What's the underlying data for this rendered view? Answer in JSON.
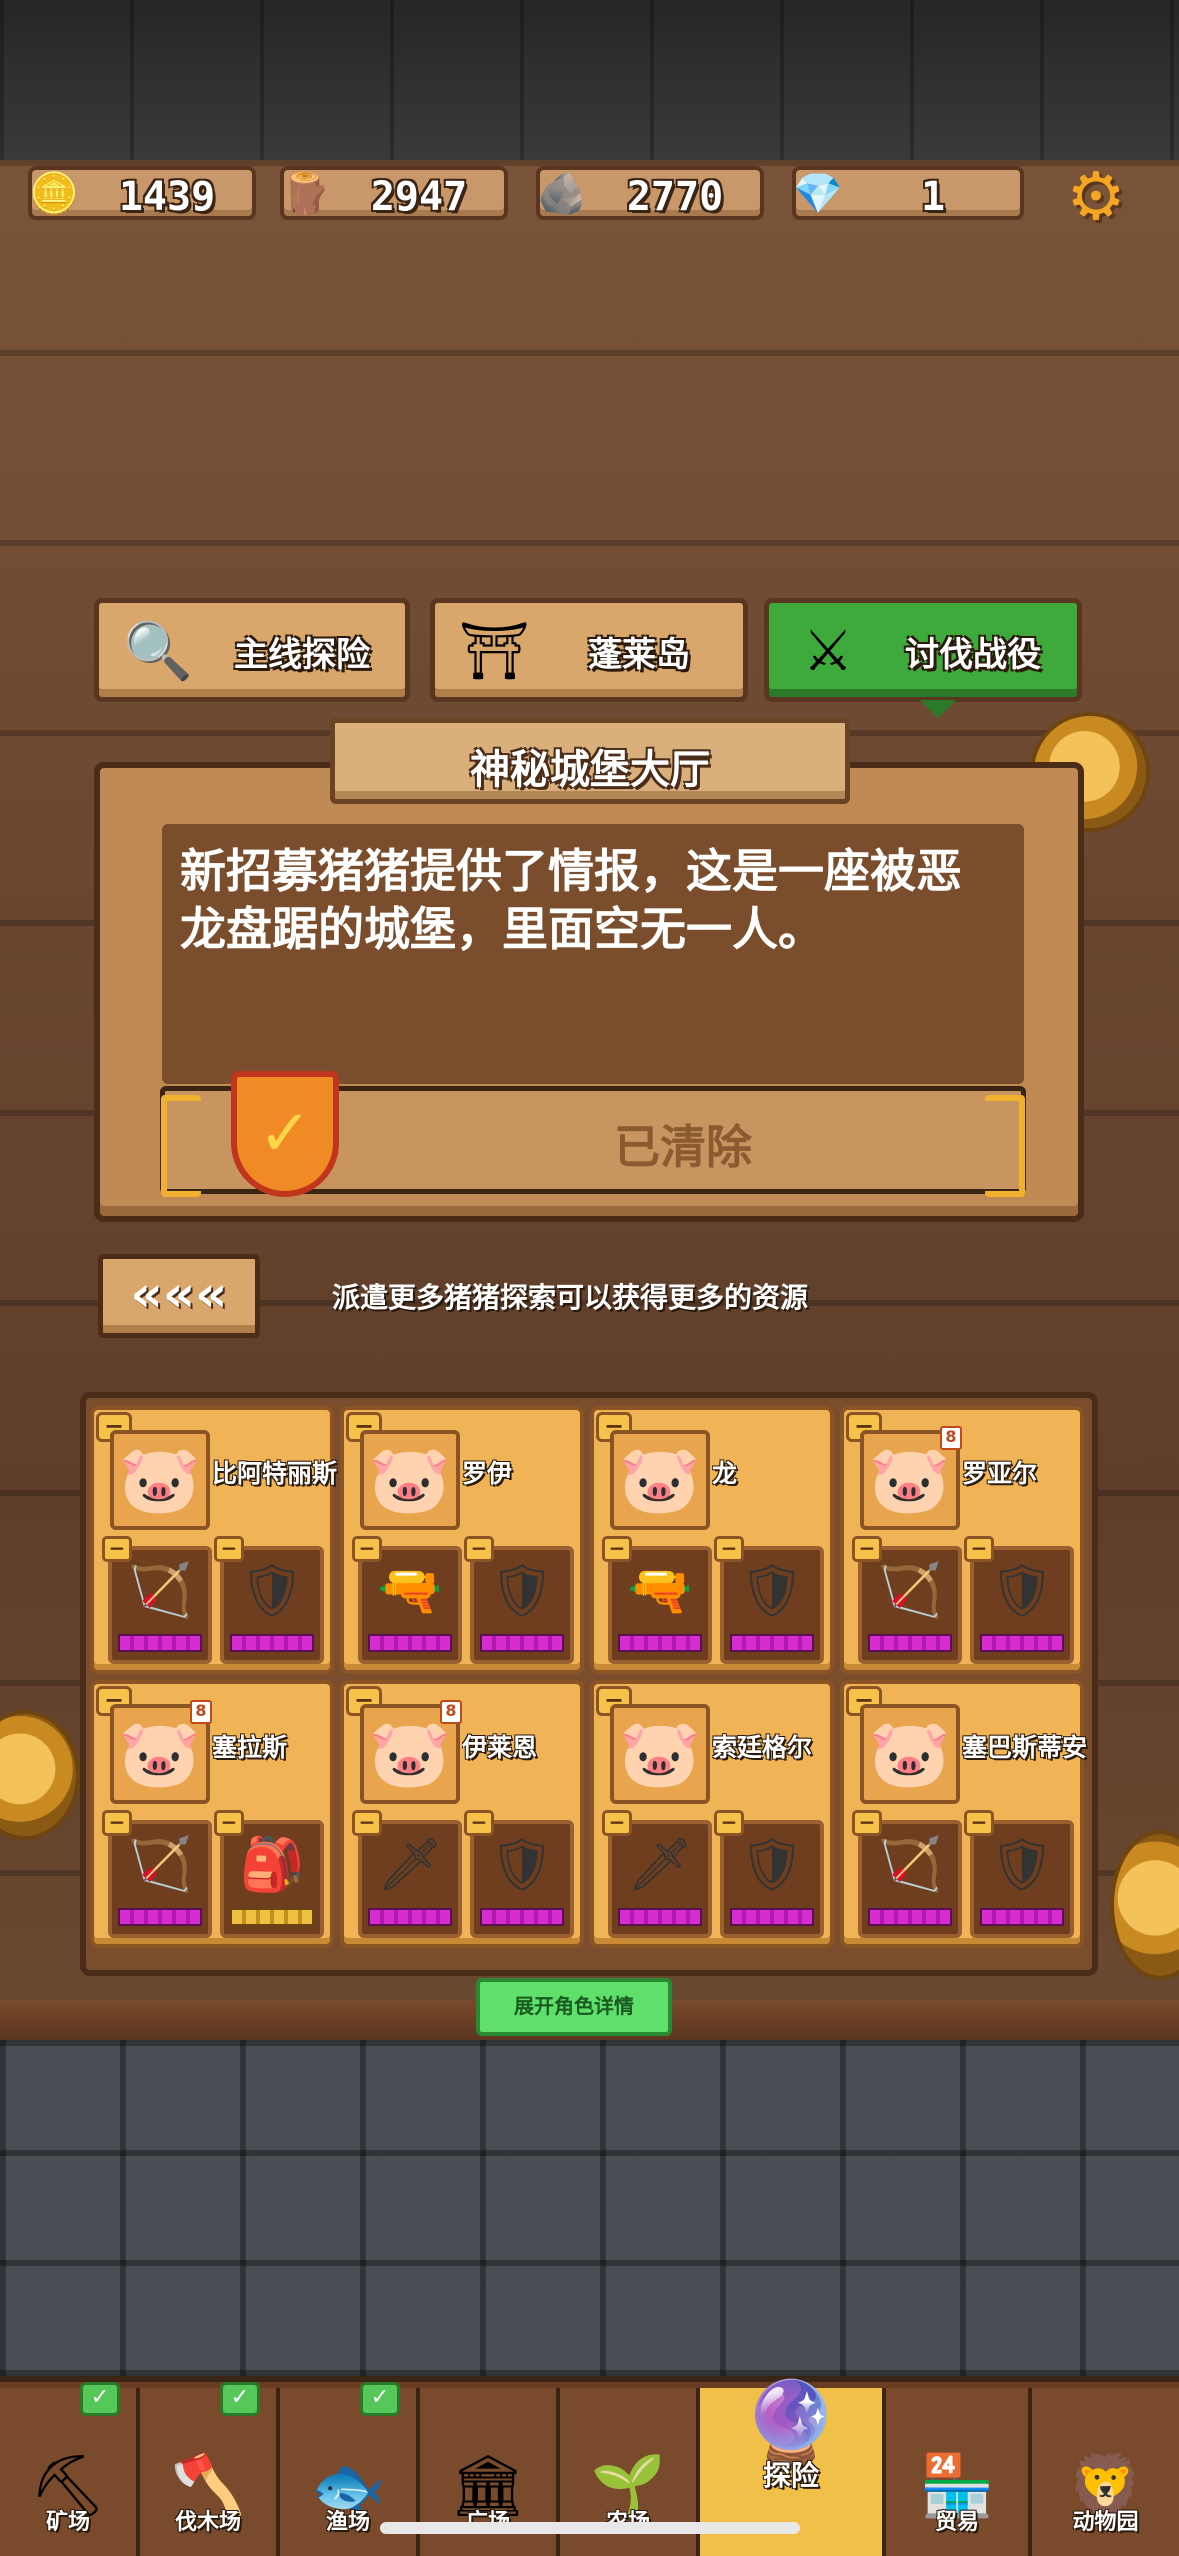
{
  "resources": [
    {
      "name": "coin-icon",
      "value": "1439",
      "glyph": "🪙"
    },
    {
      "name": "wood-icon",
      "value": "2947",
      "glyph": "🪵"
    },
    {
      "name": "stone-icon",
      "value": "2770",
      "glyph": "🪨"
    },
    {
      "name": "gem-icon",
      "value": "1",
      "glyph": "💎"
    }
  ],
  "settings_icon": "gear-icon",
  "tabs": [
    {
      "label": "主线探险",
      "icon": "magnifier-icon",
      "glyph": "🔍"
    },
    {
      "label": "蓬莱岛",
      "icon": "gate-icon",
      "glyph": "⛩"
    },
    {
      "label": "讨伐战役",
      "icon": "crossed-swords-icon",
      "glyph": "⚔"
    }
  ],
  "stage": {
    "title": "神秘城堡大厅",
    "description": "新招募猪猪提供了情报，这是一座被恶龙盘踞的城堡，里面空无一人。",
    "status": "已清除"
  },
  "back_button": "«««",
  "hint": "派遣更多猪猪探索可以获得更多的资源",
  "heroes": [
    {
      "name": "比阿特丽斯",
      "level": "",
      "face": "🐷",
      "eq1": "🏹",
      "eq2": "🛡"
    },
    {
      "name": "罗伊",
      "level": "",
      "face": "🐷",
      "eq1": "🔫",
      "eq2": "🛡"
    },
    {
      "name": "龙",
      "level": "",
      "face": "🐷",
      "eq1": "🔫",
      "eq2": "🛡"
    },
    {
      "name": "罗亚尔",
      "level": "8",
      "face": "🐷",
      "eq1": "🏹",
      "eq2": "🛡"
    },
    {
      "name": "塞拉斯",
      "level": "8",
      "face": "🐷",
      "eq1": "🏹",
      "eq2": "🎒"
    },
    {
      "name": "伊莱恩",
      "level": "8",
      "face": "🐷",
      "eq1": "🗡",
      "eq2": "🛡"
    },
    {
      "name": "索廷格尔",
      "level": "",
      "face": "🐷",
      "eq1": "🗡",
      "eq2": "🛡"
    },
    {
      "name": "塞巴斯蒂安",
      "level": "",
      "face": "🐷",
      "eq1": "🏹",
      "eq2": "🛡"
    }
  ],
  "expand_button": "展开角色详情",
  "nav": [
    {
      "label": "矿场",
      "glyph": "⛏",
      "check": true
    },
    {
      "label": "伐木场",
      "glyph": "🪓",
      "check": true
    },
    {
      "label": "渔场",
      "glyph": "🐟",
      "check": true
    },
    {
      "label": "广场",
      "glyph": "🏛",
      "check": false
    },
    {
      "label": "农场",
      "glyph": "🌱",
      "check": false
    },
    {
      "label": "探险",
      "glyph": "🔮",
      "check": false
    },
    {
      "label": "贸易",
      "glyph": "🏪",
      "check": false
    },
    {
      "label": "动物园",
      "glyph": "🦁",
      "check": false
    }
  ],
  "active_nav": "探险",
  "colors": {
    "active_tab": "#3eaa3c",
    "level_badge": "#c04a1c",
    "equip_bar": "#d62cd0"
  }
}
